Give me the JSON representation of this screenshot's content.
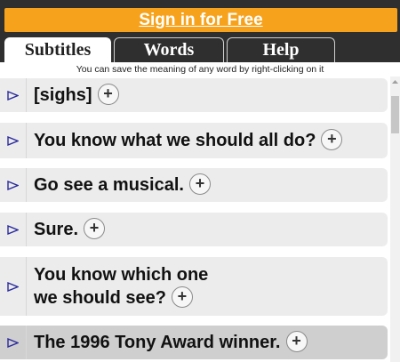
{
  "header": {
    "signin_label": "Sign in for Free"
  },
  "tabs": [
    {
      "label": "Subtitles",
      "active": true
    },
    {
      "label": "Words",
      "active": false
    },
    {
      "label": "Help",
      "active": false
    }
  ],
  "hint": "You can save the meaning of any word by right-clicking on it",
  "subtitles": [
    {
      "text": "[sighs]"
    },
    {
      "text": "You know what we should all do?"
    },
    {
      "text": "Go see a musical."
    },
    {
      "text": "Sure."
    },
    {
      "line1": "You know which one",
      "line2": "we should see?"
    },
    {
      "text": "The 1996 Tony Award winner.",
      "highlighted": true
    }
  ],
  "add_symbol": "+",
  "colors": {
    "accent": "#f7a21c",
    "topbar": "#2f2f2f",
    "row": "#ececec",
    "row_highlight": "#cfcfcf",
    "play_icon": "#2a2a9c"
  },
  "icons": {
    "play": "play-triangle-outline-icon",
    "add": "plus-circle-icon",
    "scroll_up": "chevron-up-icon"
  }
}
